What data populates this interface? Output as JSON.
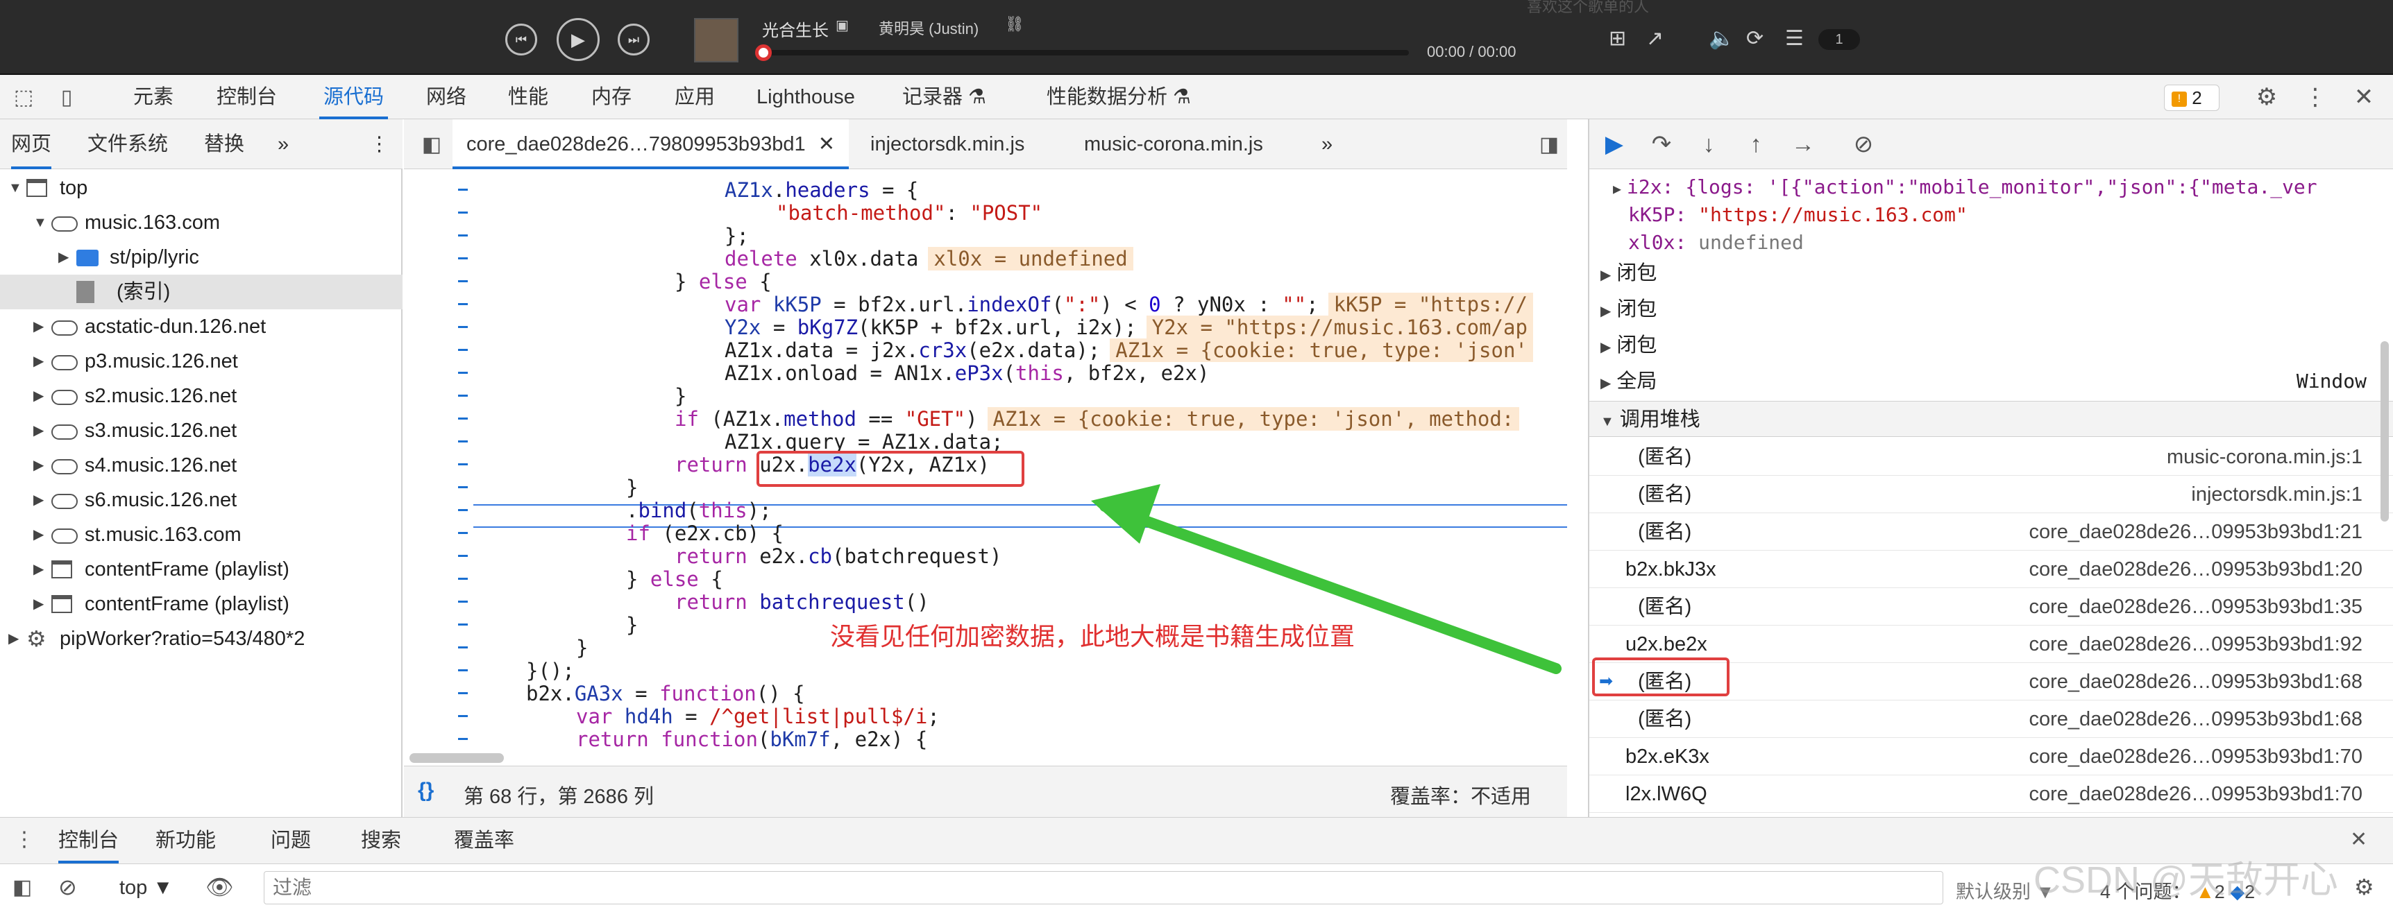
{
  "player": {
    "song_title": "光合生长",
    "artist": "黄明昊 (Justin)",
    "time": "00:00 / 00:00",
    "playlist_count": "1",
    "top_partial_text": "喜欢这个歌单的人"
  },
  "main_tabs": [
    "元素",
    "控制台",
    "源代码",
    "网络",
    "性能",
    "内存",
    "应用",
    "Lighthouse",
    "记录器 ⚗",
    "性能数据分析 ⚗"
  ],
  "issues_badge": "2",
  "navigator": {
    "tabs": [
      "网页",
      "文件系统",
      "替换"
    ],
    "more": "»",
    "tree": [
      {
        "label": "top",
        "depth": 0,
        "type": "frame",
        "open": true
      },
      {
        "label": "music.163.com",
        "depth": 1,
        "type": "cloud",
        "open": true
      },
      {
        "label": "st/pip/lyric",
        "depth": 2,
        "type": "folder",
        "open": false
      },
      {
        "label": "(索引)",
        "depth": 2,
        "type": "file",
        "selected": true
      },
      {
        "label": "acstatic-dun.126.net",
        "depth": 1,
        "type": "cloud",
        "open": false
      },
      {
        "label": "p3.music.126.net",
        "depth": 1,
        "type": "cloud",
        "open": false
      },
      {
        "label": "s2.music.126.net",
        "depth": 1,
        "type": "cloud",
        "open": false
      },
      {
        "label": "s3.music.126.net",
        "depth": 1,
        "type": "cloud",
        "open": false
      },
      {
        "label": "s4.music.126.net",
        "depth": 1,
        "type": "cloud",
        "open": false
      },
      {
        "label": "s6.music.126.net",
        "depth": 1,
        "type": "cloud",
        "open": false
      },
      {
        "label": "st.music.163.com",
        "depth": 1,
        "type": "cloud",
        "open": false
      },
      {
        "label": "contentFrame (playlist)",
        "depth": 1,
        "type": "frame",
        "open": false
      },
      {
        "label": "contentFrame (playlist)",
        "depth": 1,
        "type": "frame",
        "open": false
      },
      {
        "label": "pipWorker?ratio=543/480*2",
        "depth": 0,
        "type": "gear",
        "open": false
      }
    ]
  },
  "editor": {
    "tabs": [
      "core_dae028de26…79809953b93bd1",
      "injectorsdk.min.js",
      "music-corona.min.js"
    ],
    "tab_more": "»",
    "status_position": "第 68 行，第 2686 列",
    "coverage": "覆盖率：不适用",
    "annotation": "没看见任何加密数据，此地大概是书籍生成位置"
  },
  "scope": {
    "i2x": "i2x: {logs: '[{\"action\":\"mobile_monitor\",\"json\":{\"meta._ver",
    "kk5p_key": "kK5P:",
    "kk5p_val": "\"https://music.163.com\"",
    "xl0x_key": "xl0x:",
    "xl0x_val": "undefined",
    "closure1": "闭包",
    "closure2": "闭包",
    "closure3": "闭包",
    "global": "全局",
    "global_val": "Window",
    "call_stack": "调用堆栈"
  },
  "call_stack": [
    {
      "fn": "(匿名)",
      "loc": "music-corona.min.js:1"
    },
    {
      "fn": "(匿名)",
      "loc": "injectorsdk.min.js:1"
    },
    {
      "fn": "(匿名)",
      "loc": "core_dae028de26…09953b93bd1:21"
    },
    {
      "fn": "b2x.bkJ3x",
      "loc": "core_dae028de26…09953b93bd1:20"
    },
    {
      "fn": "(匿名)",
      "loc": "core_dae028de26…09953b93bd1:35"
    },
    {
      "fn": "u2x.be2x",
      "loc": "core_dae028de26…09953b93bd1:92"
    },
    {
      "fn": "(匿名)",
      "loc": "core_dae028de26…09953b93bd1:68",
      "current": true
    },
    {
      "fn": "(匿名)",
      "loc": "core_dae028de26…09953b93bd1:68"
    },
    {
      "fn": "b2x.eK3x",
      "loc": "core_dae028de26…09953b93bd1:70"
    },
    {
      "fn": "l2x.lW6Q",
      "loc": "core_dae028de26…09953b93bd1:70"
    }
  ],
  "drawer": {
    "tabs": [
      "控制台",
      "新功能",
      "问题",
      "搜索",
      "覆盖率"
    ],
    "context": "top ▼",
    "filter_placeholder": "过滤",
    "levels": "默认级别 ▼",
    "issues": "4 个问题：",
    "issue_warn": "2",
    "issue_info": "2",
    "watermark": "CSDN @天敌开心"
  },
  "colors": {
    "accent": "#1a6fd1",
    "highlight_box": "#e04040",
    "arrow": "#3ec23a"
  }
}
